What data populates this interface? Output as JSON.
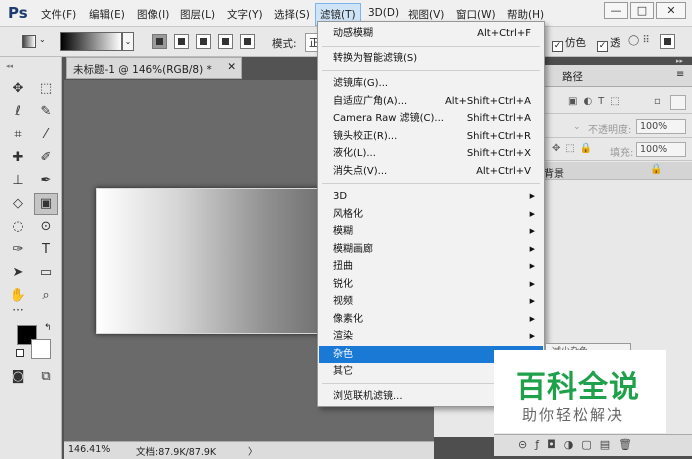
{
  "app": {
    "logo": "Ps"
  },
  "menubar": {
    "items": [
      "文件(F)",
      "编辑(E)",
      "图像(I)",
      "图层(L)",
      "文字(Y)",
      "选择(S)",
      "滤镜(T)",
      "3D(D)",
      "视图(V)",
      "窗口(W)",
      "帮助(H)"
    ],
    "active_index": 6,
    "window_controls": [
      "—",
      "□",
      "✕"
    ]
  },
  "options_bar": {
    "mode_label": "模式:",
    "mode_value": "正",
    "checkbox_simulate": "仿色",
    "checkbox_transparency": "透",
    "colors": {
      "gradient_start": "#000000",
      "gradient_end": "#ffffff"
    }
  },
  "document": {
    "tab_title": "未标题-1 @ 146%(RGB/8) *",
    "zoom": "146.41%",
    "doc_info": "文档:87.9K/87.9K",
    "status_arrow": "〉"
  },
  "panels": {
    "tab_paths": "路径",
    "opacity_label": "不透明度:",
    "opacity_value": "100%",
    "fill_label": "填充:",
    "fill_value": "100%",
    "layer_name": "背景"
  },
  "filter_menu": {
    "groups": [
      [
        {
          "label": "动感模糊",
          "shortcut": "Alt+Ctrl+F"
        }
      ],
      [
        {
          "label": "转换为智能滤镜(S)",
          "shortcut": ""
        }
      ],
      [
        {
          "label": "滤镜库(G)...",
          "shortcut": ""
        },
        {
          "label": "自适应广角(A)...",
          "shortcut": "Alt+Shift+Ctrl+A"
        },
        {
          "label": "Camera Raw 滤镜(C)...",
          "shortcut": "Shift+Ctrl+A"
        },
        {
          "label": "镜头校正(R)...",
          "shortcut": "Shift+Ctrl+R"
        },
        {
          "label": "液化(L)...",
          "shortcut": "Shift+Ctrl+X"
        },
        {
          "label": "消失点(V)...",
          "shortcut": "Alt+Ctrl+V"
        }
      ],
      [
        {
          "label": "3D",
          "submenu": true
        },
        {
          "label": "风格化",
          "submenu": true
        },
        {
          "label": "模糊",
          "submenu": true
        },
        {
          "label": "模糊画廊",
          "submenu": true
        },
        {
          "label": "扭曲",
          "submenu": true
        },
        {
          "label": "锐化",
          "submenu": true
        },
        {
          "label": "视频",
          "submenu": true
        },
        {
          "label": "像素化",
          "submenu": true
        },
        {
          "label": "渲染",
          "submenu": true
        },
        {
          "label": "杂色",
          "submenu": true,
          "highlighted": true
        },
        {
          "label": "其它",
          "submenu": true
        }
      ],
      [
        {
          "label": "浏览联机滤镜...",
          "shortcut": ""
        }
      ]
    ],
    "submenu_peek": "减少杂色..."
  },
  "watermark": {
    "title": "百科全说",
    "subtitle": "助你轻松解决"
  },
  "colors": {
    "menu_highlight": "#1979d5",
    "watermark_green": "#1fa04a"
  }
}
